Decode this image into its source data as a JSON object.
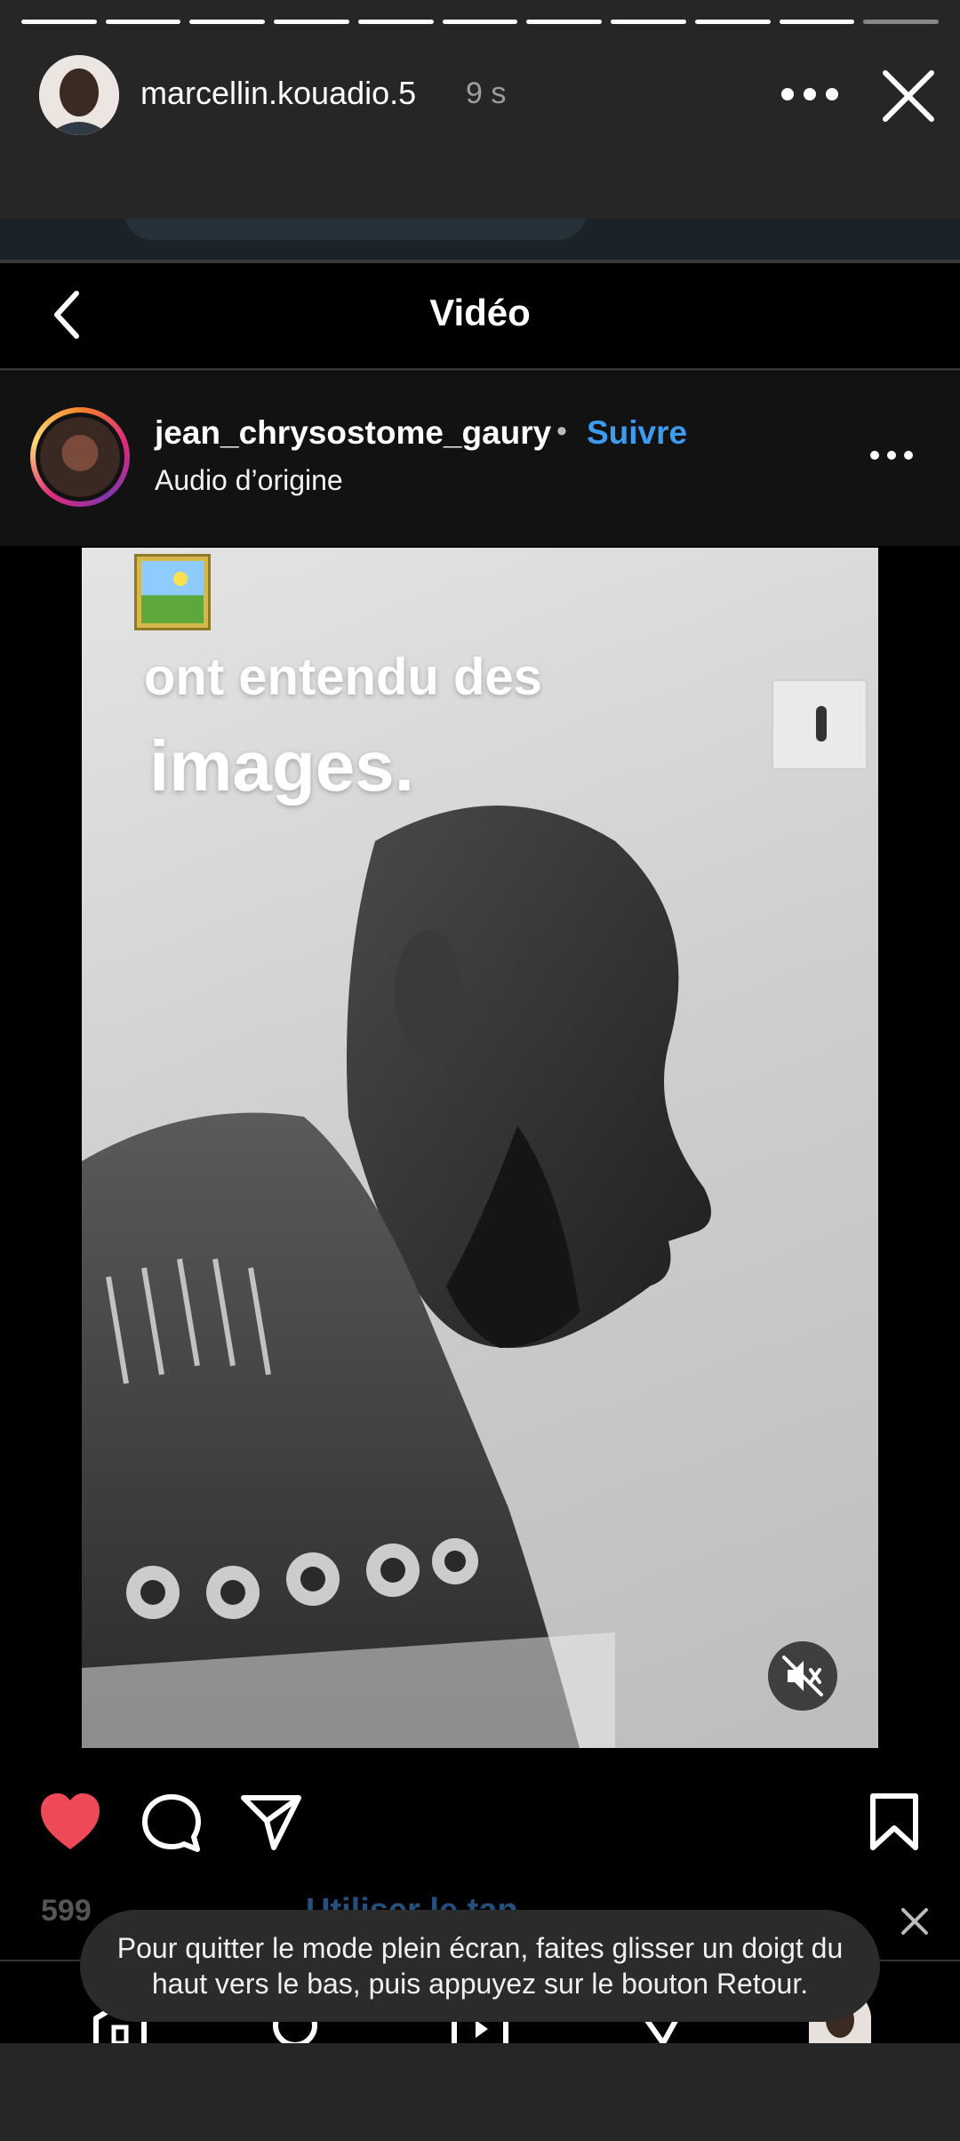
{
  "story": {
    "username": "marcellin.kouadio.5",
    "time": "9 s",
    "segments_total": 11,
    "segments_completed": 10
  },
  "embed": {
    "nav_title": "Vidéo",
    "post": {
      "username": "jean_chrysostome_gaury",
      "separator": "•",
      "follow_label": "Suivre",
      "audio": "Audio d’origine"
    },
    "video": {
      "caption_line1": "ont entendu des",
      "caption_line2": "images."
    },
    "faded_likes": "599",
    "faded_link": "Utiliser le tan"
  },
  "toast": {
    "text": "Pour quitter le mode plein écran, faites glisser un doigt du haut vers le bas, puis appuyez sur le bouton Retour."
  },
  "colors": {
    "like": "#ed4956",
    "follow": "#3d9bf0",
    "background": "#262626"
  },
  "icons": [
    "more-icon",
    "close-icon",
    "back-icon",
    "heart-icon",
    "comment-icon",
    "share-icon",
    "bookmark-icon",
    "mute-icon",
    "home-icon",
    "search-icon",
    "reels-icon",
    "send-icon"
  ]
}
